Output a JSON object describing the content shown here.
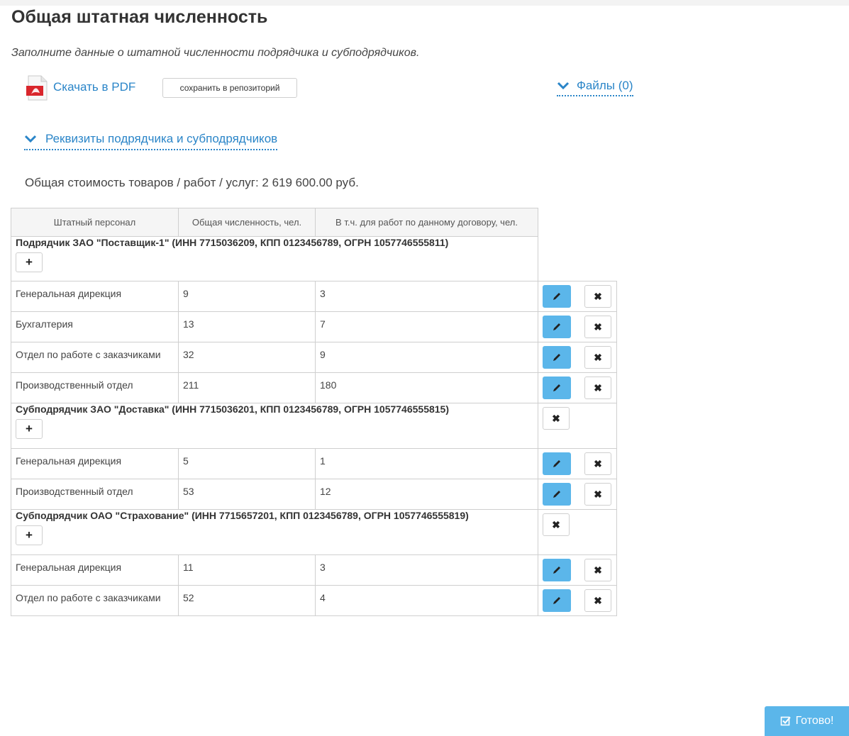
{
  "page": {
    "title": "Общая штатная численность",
    "subtitle": "Заполните данные о штатной численности подрядчика и субподрядчиков."
  },
  "toolbar": {
    "pdf_label": "Скачать в PDF",
    "repo_label": "сохранить в репозиторий",
    "files_label": "Файлы (0)"
  },
  "requisites_label": "Реквизиты подрядчика и субподрядчиков",
  "total_label": "Общая стоимость товаров / работ / услуг: 2 619 600.00 руб.",
  "table": {
    "headers": [
      "Штатный персонал",
      "Общая численность, чел.",
      "В т.ч. для работ по данному договору, чел."
    ],
    "groups": [
      {
        "name": "Подрядчик ЗАО \"Поставщик-1\" (ИНН 7715036209, КПП 0123456789, ОГРН 1057746555811)",
        "rows": [
          [
            "Генеральная дирекция",
            "9",
            "3"
          ],
          [
            "Бухгалтерия",
            "13",
            "7"
          ],
          [
            "Отдел по работе с заказчиками",
            "32",
            "9"
          ],
          [
            "Производственный отдел",
            "211",
            "180"
          ]
        ]
      },
      {
        "name": "Субподрядчик ЗАО \"Доставка\" (ИНН 7715036201, КПП 0123456789, ОГРН 1057746555815)",
        "rows": [
          [
            "Генеральная дирекция",
            "5",
            "1"
          ],
          [
            "Производственный отдел",
            "53",
            "12"
          ]
        ]
      },
      {
        "name": "Субподрядчик ОАО \"Страхование\" (ИНН 7715657201, КПП 0123456789, ОГРН 1057746555819)",
        "rows": [
          [
            "Генеральная дирекция",
            "11",
            "3"
          ],
          [
            "Отдел по работе с заказчиками",
            "52",
            "4"
          ]
        ]
      }
    ]
  },
  "done_label": "Готово!",
  "colors": {
    "accent": "#2a85c8",
    "button_blue": "#5bb6ea",
    "border": "#cfcfcf"
  },
  "icons": {
    "pdf": "pdf-icon",
    "chevron": "chevron-down-icon",
    "plus": "plus-icon",
    "edit": "pencil-icon",
    "delete": "close-icon",
    "check": "checkbox-check-icon"
  }
}
